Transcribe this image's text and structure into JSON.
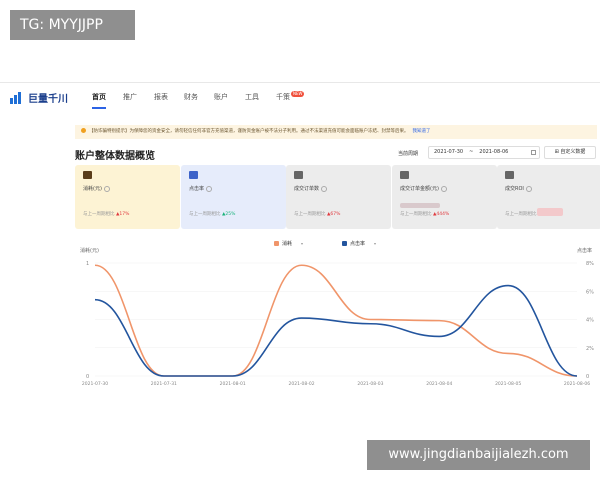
{
  "watermarks": {
    "top_left": "TG: MYYJJPP",
    "bottom_right": "www.jingdianbaijialezh.com"
  },
  "nav": {
    "logo": "巨量千川",
    "items": [
      "首页",
      "推广",
      "报表",
      "财务",
      "账户",
      "工具",
      "千策"
    ],
    "active_index": 0,
    "badge": "NEW"
  },
  "notice": {
    "text": "【防诈骗特别提示】为保障您的资金安全，请勿轻信任何非官方充值渠道，谨防资金账户被不法分子利用。通过不法渠道充值可能会面临账户冻结、封禁等后果。",
    "link": "我知道了"
  },
  "overview": {
    "title": "账户整体数据概览",
    "period_label": "当前周期",
    "date_start": "2021-07-30",
    "date_sep": "~",
    "date_end": "2021-08-06",
    "custom_button": "自定义数据"
  },
  "cards": [
    {
      "label": "消耗(元)",
      "compare": "与上一周期相比",
      "change": "▲17%",
      "icon": "wallet-icon",
      "bg": "#fdf3d4",
      "icon_color": "#5a3d1a",
      "trend": "up"
    },
    {
      "label": "点击率",
      "compare": "与上一周期相比",
      "change": "▲25%",
      "icon": "click-icon",
      "bg": "#e6ecfb",
      "icon_color": "#3d63c9",
      "trend": "up-green"
    },
    {
      "label": "成交订单数",
      "compare": "与上一周期相比",
      "change": "▲67%",
      "icon": "order-icon",
      "bg": "#ececec",
      "icon_color": "#666666",
      "trend": "up"
    },
    {
      "label": "成交订单金额(元)",
      "compare": "与上一周期相比",
      "change": "▲444%",
      "icon": "bag-icon",
      "bg": "#ececec",
      "icon_color": "#666666",
      "trend": "up"
    },
    {
      "label": "成交ROI",
      "compare": "与上一周期相比",
      "change": "",
      "icon": "filter-icon",
      "bg": "#ececec",
      "icon_color": "#666666",
      "trend": "none"
    }
  ],
  "chart": {
    "legend": [
      {
        "name": "消耗",
        "color": "#f0956a"
      },
      {
        "name": "点击率",
        "color": "#23559e"
      }
    ],
    "left_axis_title": "消耗(元)",
    "right_axis_title": "点击率"
  },
  "chart_data": {
    "type": "line",
    "x": [
      "2021-07-30",
      "2021-07-31",
      "2021-08-01",
      "2021-08-02",
      "2021-08-03",
      "2021-08-04",
      "2021-08-05",
      "2021-08-06"
    ],
    "y_left_ticks": [
      "0",
      "1"
    ],
    "y_left_range": [
      0,
      1
    ],
    "y_right_ticks": [
      "0",
      "2%",
      "4%",
      "6%",
      "8%"
    ],
    "y_right_range": [
      0,
      8
    ],
    "series": [
      {
        "name": "消耗",
        "axis": "left",
        "color": "#f0956a",
        "values": [
          0.98,
          0,
          0,
          0.98,
          0.5,
          0.49,
          0.2,
          0
        ]
      },
      {
        "name": "点击率",
        "axis": "right",
        "color": "#23559e",
        "values": [
          5.4,
          0,
          0,
          4.1,
          3.7,
          2.8,
          6.4,
          0
        ]
      }
    ]
  }
}
